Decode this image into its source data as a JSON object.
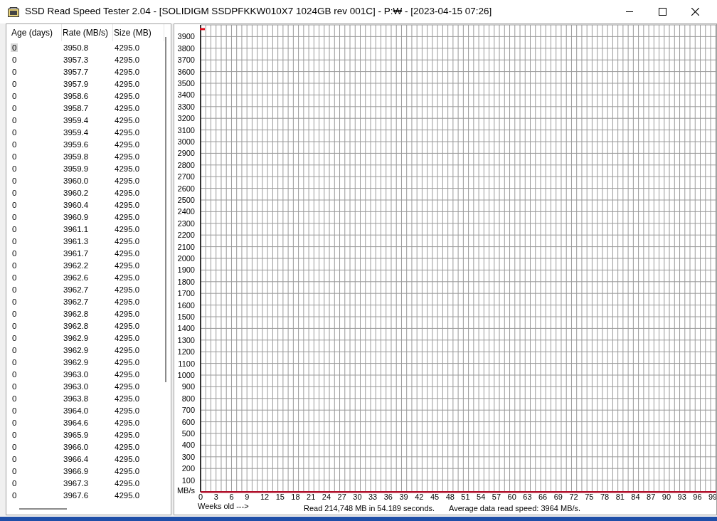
{
  "window": {
    "title": "SSD Read Speed Tester 2.04 - [SOLIDIGM SSDPFKKW010X7 1024GB rev 001C] - P:₩ - [2023-04-15 07:26]"
  },
  "table": {
    "columns": [
      "Age (days)",
      "Rate (MB/s)",
      "Size (MB)"
    ],
    "rows": [
      {
        "cells": [
          "0",
          "3950.8",
          "4295.0"
        ],
        "selected": true
      },
      {
        "cells": [
          "0",
          "3957.3",
          "4295.0"
        ],
        "selected": false
      },
      {
        "cells": [
          "0",
          "3957.7",
          "4295.0"
        ],
        "selected": false
      },
      {
        "cells": [
          "0",
          "3957.9",
          "4295.0"
        ],
        "selected": false
      },
      {
        "cells": [
          "0",
          "3958.6",
          "4295.0"
        ],
        "selected": false
      },
      {
        "cells": [
          "0",
          "3958.7",
          "4295.0"
        ],
        "selected": false
      },
      {
        "cells": [
          "0",
          "3959.4",
          "4295.0"
        ],
        "selected": false
      },
      {
        "cells": [
          "0",
          "3959.4",
          "4295.0"
        ],
        "selected": false
      },
      {
        "cells": [
          "0",
          "3959.6",
          "4295.0"
        ],
        "selected": false
      },
      {
        "cells": [
          "0",
          "3959.8",
          "4295.0"
        ],
        "selected": false
      },
      {
        "cells": [
          "0",
          "3959.9",
          "4295.0"
        ],
        "selected": false
      },
      {
        "cells": [
          "0",
          "3960.0",
          "4295.0"
        ],
        "selected": false
      },
      {
        "cells": [
          "0",
          "3960.2",
          "4295.0"
        ],
        "selected": false
      },
      {
        "cells": [
          "0",
          "3960.4",
          "4295.0"
        ],
        "selected": false
      },
      {
        "cells": [
          "0",
          "3960.9",
          "4295.0"
        ],
        "selected": false
      },
      {
        "cells": [
          "0",
          "3961.1",
          "4295.0"
        ],
        "selected": false
      },
      {
        "cells": [
          "0",
          "3961.3",
          "4295.0"
        ],
        "selected": false
      },
      {
        "cells": [
          "0",
          "3961.7",
          "4295.0"
        ],
        "selected": false
      },
      {
        "cells": [
          "0",
          "3962.2",
          "4295.0"
        ],
        "selected": false
      },
      {
        "cells": [
          "0",
          "3962.6",
          "4295.0"
        ],
        "selected": false
      },
      {
        "cells": [
          "0",
          "3962.7",
          "4295.0"
        ],
        "selected": false
      },
      {
        "cells": [
          "0",
          "3962.7",
          "4295.0"
        ],
        "selected": false
      },
      {
        "cells": [
          "0",
          "3962.8",
          "4295.0"
        ],
        "selected": false
      },
      {
        "cells": [
          "0",
          "3962.8",
          "4295.0"
        ],
        "selected": false
      },
      {
        "cells": [
          "0",
          "3962.9",
          "4295.0"
        ],
        "selected": false
      },
      {
        "cells": [
          "0",
          "3962.9",
          "4295.0"
        ],
        "selected": false
      },
      {
        "cells": [
          "0",
          "3962.9",
          "4295.0"
        ],
        "selected": false
      },
      {
        "cells": [
          "0",
          "3963.0",
          "4295.0"
        ],
        "selected": false
      },
      {
        "cells": [
          "0",
          "3963.0",
          "4295.0"
        ],
        "selected": false
      },
      {
        "cells": [
          "0",
          "3963.8",
          "4295.0"
        ],
        "selected": false
      },
      {
        "cells": [
          "0",
          "3964.0",
          "4295.0"
        ],
        "selected": false
      },
      {
        "cells": [
          "0",
          "3964.6",
          "4295.0"
        ],
        "selected": false
      },
      {
        "cells": [
          "0",
          "3965.9",
          "4295.0"
        ],
        "selected": false
      },
      {
        "cells": [
          "0",
          "3966.0",
          "4295.0"
        ],
        "selected": false
      },
      {
        "cells": [
          "0",
          "3966.4",
          "4295.0"
        ],
        "selected": false
      },
      {
        "cells": [
          "0",
          "3966.9",
          "4295.0"
        ],
        "selected": false
      },
      {
        "cells": [
          "0",
          "3967.3",
          "4295.0"
        ],
        "selected": false
      },
      {
        "cells": [
          "0",
          "3967.6",
          "4295.0"
        ],
        "selected": false
      }
    ]
  },
  "chart": {
    "chart_data": {
      "type": "scatter",
      "xlabel": "Weeks old --->",
      "ylabel": "MB/s",
      "x": [
        0
      ],
      "series": [
        {
          "color": "#e0101e",
          "values": [
            3964
          ]
        }
      ],
      "grid": true,
      "xlim": [
        0,
        99
      ],
      "ylim": [
        0,
        4000
      ],
      "xticks": [
        0,
        3,
        6,
        9,
        12,
        15,
        18,
        21,
        24,
        27,
        30,
        33,
        36,
        39,
        42,
        45,
        48,
        51,
        54,
        57,
        60,
        63,
        66,
        69,
        72,
        75,
        78,
        81,
        84,
        87,
        90,
        93,
        96,
        99
      ],
      "yticks": [
        100,
        200,
        300,
        400,
        500,
        600,
        700,
        800,
        900,
        1000,
        1100,
        1200,
        1300,
        1400,
        1500,
        1600,
        1700,
        1800,
        1900,
        2000,
        2100,
        2200,
        2300,
        2400,
        2500,
        2600,
        2700,
        2800,
        2900,
        3000,
        3100,
        3200,
        3300,
        3400,
        3500,
        3600,
        3700,
        3800,
        3900
      ]
    }
  },
  "status": [
    "Read 214,748 MB in 54.189 seconds.",
    "Average data read speed: 3964 MB/s."
  ]
}
